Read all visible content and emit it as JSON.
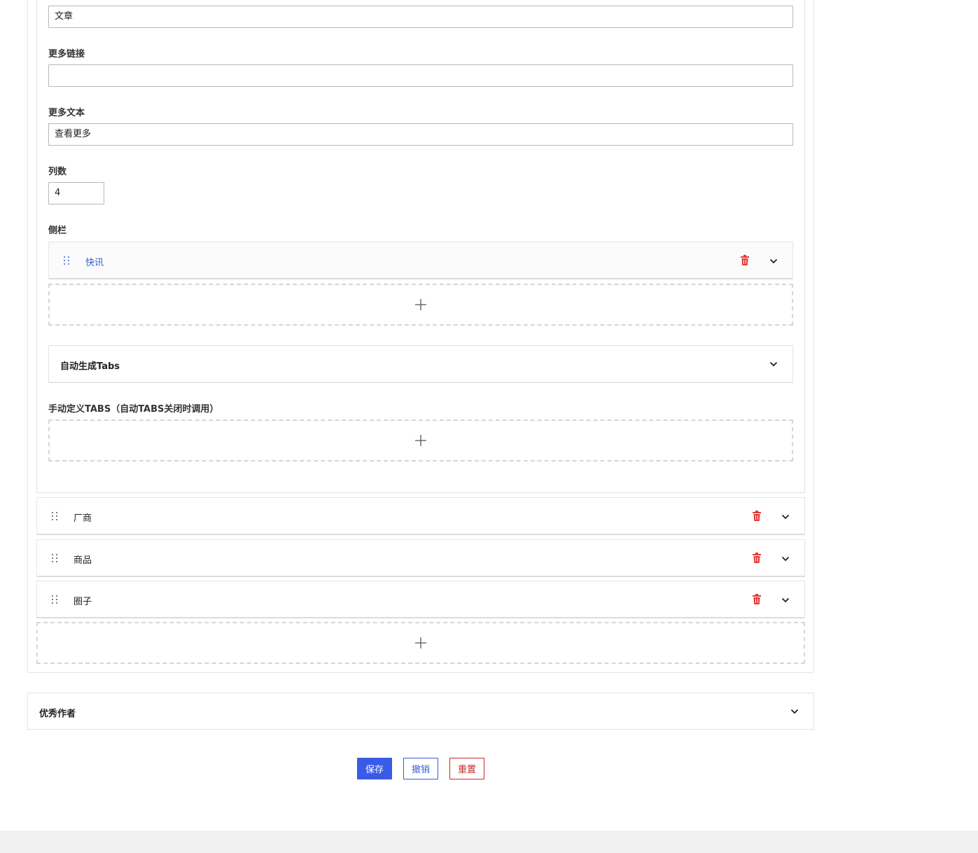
{
  "fields": {
    "article": {
      "value": "文章"
    },
    "more_link": {
      "label": "更多链接",
      "value": ""
    },
    "more_text": {
      "label": "更多文本",
      "value": "查看更多"
    },
    "columns": {
      "label": "列数",
      "value": "4"
    },
    "sidebar": {
      "label": "侧栏",
      "items": [
        {
          "label": "快讯"
        }
      ]
    }
  },
  "auto_tabs": {
    "title": "自动生成Tabs"
  },
  "manual_tabs": {
    "label": "手动定义TABS（自动TABS关闭时调用）"
  },
  "modules": [
    {
      "label": "厂商"
    },
    {
      "label": "商品"
    },
    {
      "label": "圈子"
    }
  ],
  "sections": {
    "excellent_authors": {
      "title": "优秀作者"
    }
  },
  "actions": {
    "save": "保存",
    "cancel": "撤销",
    "reset": "重置"
  },
  "colors": {
    "primary": "#3a5be8",
    "danger": "#e53935",
    "reset": "#c62828",
    "footer": "#f0f0f0"
  },
  "icons": {
    "drag": "drag-handle-icon",
    "trash": "trash-icon",
    "chevron": "chevron-down-icon",
    "plus": "plus-icon"
  }
}
